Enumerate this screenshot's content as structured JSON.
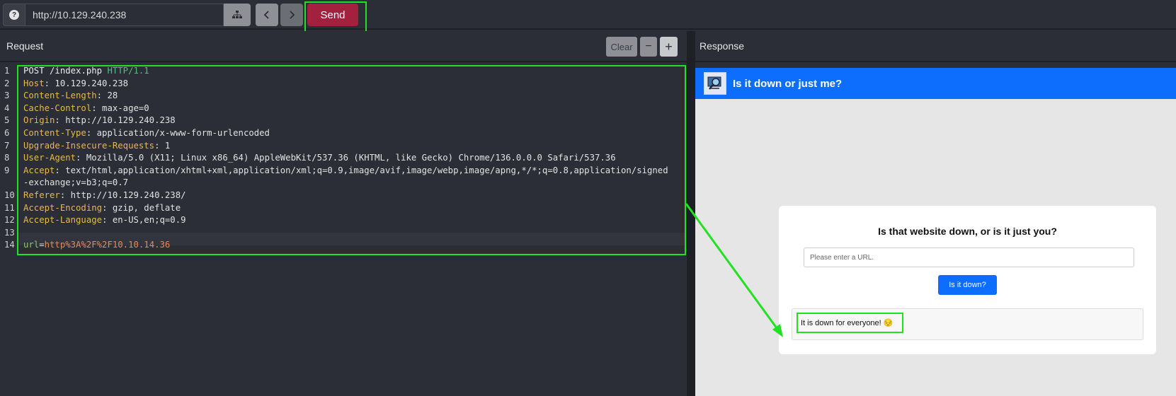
{
  "toolbar": {
    "help_label": "?",
    "url": "http://10.129.240.238",
    "send_label": "Send"
  },
  "request": {
    "title": "Request",
    "clear_label": "Clear",
    "minus_label": "−",
    "plus_label": "+",
    "line_numbers": [
      "1",
      "2",
      "3",
      "4",
      "5",
      "6",
      "7",
      "8",
      "9",
      "10",
      "11",
      "12",
      "13",
      "14"
    ],
    "method": "POST",
    "path": " /index.php ",
    "protocol": "HTTP/1.1",
    "headers": [
      {
        "key": "Host",
        "value": ": 10.129.240.238"
      },
      {
        "key": "Content-Length",
        "value": ": 28"
      },
      {
        "key": "Cache-Control",
        "value": ": max-age=0"
      },
      {
        "key": "Origin",
        "value": ": http://10.129.240.238"
      },
      {
        "key": "Content-Type",
        "value": ": application/x-www-form-urlencoded"
      },
      {
        "key": "Upgrade-Insecure-Requests",
        "value": ": 1"
      },
      {
        "key": "User-Agent",
        "value": ": Mozilla/5.0 (X11; Linux x86_64) AppleWebKit/537.36 (KHTML, like Gecko) Chrome/136.0.0.0 Safari/537.36"
      },
      {
        "key": "Accept",
        "value": ": text/html,application/xhtml+xml,application/xml;q=0.9,image/avif,image/webp,image/apng,*/*;q=0.8,application/signed"
      },
      {
        "key": "Referer",
        "value": ": http://10.129.240.238/"
      },
      {
        "key": "Accept-Encoding",
        "value": ": gzip, deflate"
      },
      {
        "key": "Accept-Language",
        "value": ": en-US,en;q=0.9"
      }
    ],
    "accept_wrap": "-exchange;v=b3;q=0.7",
    "body_key": "url",
    "body_eq": "=",
    "body_value": "http%3A%2F%2F10.10.14.36"
  },
  "response": {
    "title": "Response",
    "site_title": "Is it down or just me?",
    "card_title": "Is that website down, or is it just you?",
    "input_placeholder": "Please enter a URL.",
    "check_label": "Is it down?",
    "result": "It is down for everyone! 😔"
  },
  "colors": {
    "send": "#a3203f",
    "highlight": "#22e022",
    "site_blue": "#0d6efd",
    "header_key": "#e8b84a"
  }
}
